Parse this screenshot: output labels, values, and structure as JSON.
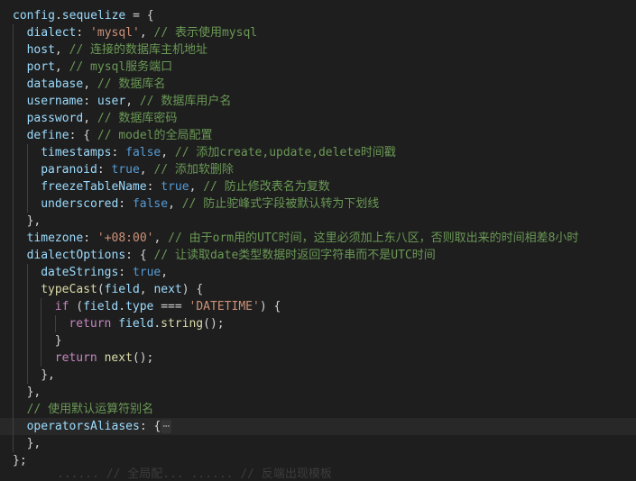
{
  "editor": {
    "lines": [
      {
        "tokens": [
          [
            "v",
            "config"
          ],
          [
            "p",
            "."
          ],
          [
            "v",
            "sequelize"
          ],
          [
            "p",
            " = {"
          ]
        ]
      },
      {
        "tokens": [
          [
            "v",
            "dialect"
          ],
          [
            "p",
            ": "
          ],
          [
            "s",
            "'mysql'"
          ],
          [
            "p",
            ", "
          ],
          [
            "c",
            "// 表示使用mysql"
          ]
        ]
      },
      {
        "tokens": [
          [
            "v",
            "host"
          ],
          [
            "p",
            ", "
          ],
          [
            "c",
            "// 连接的数据库主机地址"
          ]
        ]
      },
      {
        "tokens": [
          [
            "v",
            "port"
          ],
          [
            "p",
            ", "
          ],
          [
            "c",
            "// mysql服务端口"
          ]
        ]
      },
      {
        "tokens": [
          [
            "v",
            "database"
          ],
          [
            "p",
            ", "
          ],
          [
            "c",
            "// 数据库名"
          ]
        ]
      },
      {
        "tokens": [
          [
            "v",
            "username"
          ],
          [
            "p",
            ": "
          ],
          [
            "v",
            "user"
          ],
          [
            "p",
            ", "
          ],
          [
            "c",
            "// 数据库用户名"
          ]
        ]
      },
      {
        "tokens": [
          [
            "v",
            "password"
          ],
          [
            "p",
            ", "
          ],
          [
            "c",
            "// 数据库密码"
          ]
        ]
      },
      {
        "tokens": [
          [
            "v",
            "define"
          ],
          [
            "p",
            ": { "
          ],
          [
            "c",
            "// model的全局配置"
          ]
        ]
      },
      {
        "tokens": [
          [
            "v",
            "timestamps"
          ],
          [
            "p",
            ": "
          ],
          [
            "k",
            "false"
          ],
          [
            "p",
            ", "
          ],
          [
            "c",
            "// 添加create,update,delete时间戳"
          ]
        ]
      },
      {
        "tokens": [
          [
            "v",
            "paranoid"
          ],
          [
            "p",
            ": "
          ],
          [
            "k",
            "true"
          ],
          [
            "p",
            ", "
          ],
          [
            "c",
            "// 添加软删除"
          ]
        ]
      },
      {
        "tokens": [
          [
            "v",
            "freezeTableName"
          ],
          [
            "p",
            ": "
          ],
          [
            "k",
            "true"
          ],
          [
            "p",
            ", "
          ],
          [
            "c",
            "// 防止修改表名为复数"
          ]
        ]
      },
      {
        "tokens": [
          [
            "v",
            "underscored"
          ],
          [
            "p",
            ": "
          ],
          [
            "k",
            "false"
          ],
          [
            "p",
            ", "
          ],
          [
            "c",
            "// 防止驼峰式字段被默认转为下划线"
          ]
        ]
      },
      {
        "tokens": [
          [
            "p",
            "},"
          ]
        ]
      },
      {
        "tokens": [
          [
            "v",
            "timezone"
          ],
          [
            "p",
            ": "
          ],
          [
            "s",
            "'+08:00'"
          ],
          [
            "p",
            ", "
          ],
          [
            "c",
            "// 由于orm用的UTC时间，这里必须加上东八区，否则取出来的时间相差8小时"
          ]
        ]
      },
      {
        "tokens": [
          [
            "v",
            "dialectOptions"
          ],
          [
            "p",
            ": { "
          ],
          [
            "c",
            "// 让读取date类型数据时返回字符串而不是UTC时间"
          ]
        ]
      },
      {
        "tokens": [
          [
            "v",
            "dateStrings"
          ],
          [
            "p",
            ": "
          ],
          [
            "k",
            "true"
          ],
          [
            "p",
            ","
          ]
        ]
      },
      {
        "tokens": [
          [
            "f",
            "typeCast"
          ],
          [
            "p",
            "("
          ],
          [
            "v",
            "field"
          ],
          [
            "p",
            ", "
          ],
          [
            "v",
            "next"
          ],
          [
            "p",
            ") {"
          ]
        ]
      },
      {
        "tokens": [
          [
            "kc",
            "if"
          ],
          [
            "p",
            " ("
          ],
          [
            "v",
            "field"
          ],
          [
            "p",
            "."
          ],
          [
            "v",
            "type"
          ],
          [
            "p",
            " === "
          ],
          [
            "s",
            "'DATETIME'"
          ],
          [
            "p",
            ") {"
          ]
        ]
      },
      {
        "tokens": [
          [
            "kc",
            "return"
          ],
          [
            "p",
            " "
          ],
          [
            "v",
            "field"
          ],
          [
            "p",
            "."
          ],
          [
            "f",
            "string"
          ],
          [
            "p",
            "();"
          ]
        ]
      },
      {
        "tokens": [
          [
            "p",
            "}"
          ]
        ]
      },
      {
        "tokens": [
          [
            "kc",
            "return"
          ],
          [
            "p",
            " "
          ],
          [
            "f",
            "next"
          ],
          [
            "p",
            "();"
          ]
        ]
      },
      {
        "tokens": [
          [
            "p",
            "},"
          ]
        ]
      },
      {
        "tokens": [
          [
            "p",
            "},"
          ]
        ]
      },
      {
        "tokens": [
          [
            "c",
            "// 使用默认运算符别名"
          ]
        ]
      },
      {
        "tokens": [
          [
            "v",
            "operatorsAliases"
          ],
          [
            "p",
            ": {"
          ],
          [
            "fold",
            "⋯"
          ]
        ]
      },
      {
        "tokens": [
          [
            "p",
            "},"
          ]
        ]
      },
      {
        "tokens": [
          [
            "p",
            "};"
          ]
        ]
      }
    ],
    "cut_off_text": "...... // 全局配... ...... // 反端出现模板"
  }
}
